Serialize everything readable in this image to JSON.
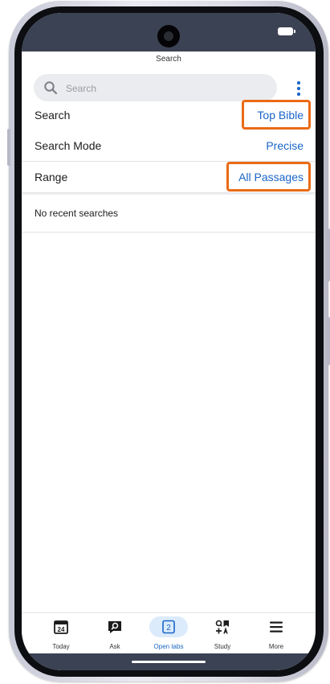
{
  "header": {
    "title": "Search"
  },
  "search": {
    "placeholder": "Search"
  },
  "settings": [
    {
      "label": "Search",
      "value": "Top Bible"
    },
    {
      "label": "Search Mode",
      "value": "Precise"
    },
    {
      "label": "Range",
      "value": "All Passages"
    }
  ],
  "recent": {
    "empty_text": "No recent searches"
  },
  "tabs": [
    {
      "label": "Today",
      "icon": "calendar-icon",
      "badge": "24"
    },
    {
      "label": "Ask",
      "icon": "ask-search-icon"
    },
    {
      "label": "Open tabs",
      "icon": "tabs-icon",
      "badge": "2",
      "active": true
    },
    {
      "label": "Study",
      "icon": "study-icon"
    },
    {
      "label": "More",
      "icon": "menu-icon"
    }
  ],
  "colors": {
    "accent": "#1a66c8",
    "highlight": "#ea6b16",
    "status_bar": "#3b4253",
    "active_tab_bg": "#dcebfb"
  }
}
